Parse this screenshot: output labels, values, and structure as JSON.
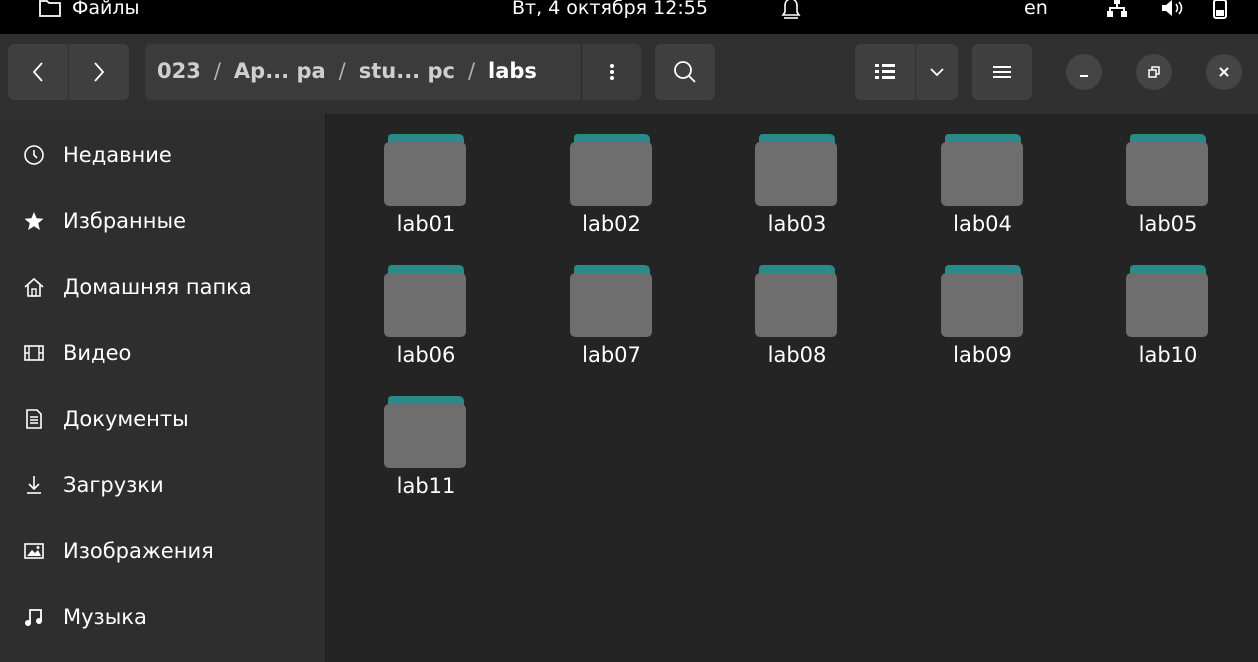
{
  "topbar": {
    "app_name": "Файлы",
    "clock": "Вт, 4 октября  12:55",
    "keyboard_layout": "en"
  },
  "header": {
    "path": [
      "023",
      "Ap... pa",
      "stu... pc"
    ],
    "path_current": "labs",
    "path_separator": "/"
  },
  "sidebar": {
    "items": [
      {
        "label": "Недавние",
        "icon": "clock-icon"
      },
      {
        "label": "Избранные",
        "icon": "star-icon"
      },
      {
        "label": "Домашняя папка",
        "icon": "home-icon"
      },
      {
        "label": "Видео",
        "icon": "film-icon"
      },
      {
        "label": "Документы",
        "icon": "document-icon"
      },
      {
        "label": "Загрузки",
        "icon": "download-icon"
      },
      {
        "label": "Изображения",
        "icon": "image-icon"
      },
      {
        "label": "Музыка",
        "icon": "music-icon"
      }
    ]
  },
  "files": [
    {
      "name": "lab01"
    },
    {
      "name": "lab02"
    },
    {
      "name": "lab03"
    },
    {
      "name": "lab04"
    },
    {
      "name": "lab05"
    },
    {
      "name": "lab06"
    },
    {
      "name": "lab07"
    },
    {
      "name": "lab08"
    },
    {
      "name": "lab09"
    },
    {
      "name": "lab10"
    },
    {
      "name": "lab11"
    }
  ],
  "colors": {
    "folder_tab": "#2a8a8a",
    "folder_body": "#6e6e6e",
    "sidebar_bg": "#2e2e2e",
    "main_bg": "#242424"
  }
}
